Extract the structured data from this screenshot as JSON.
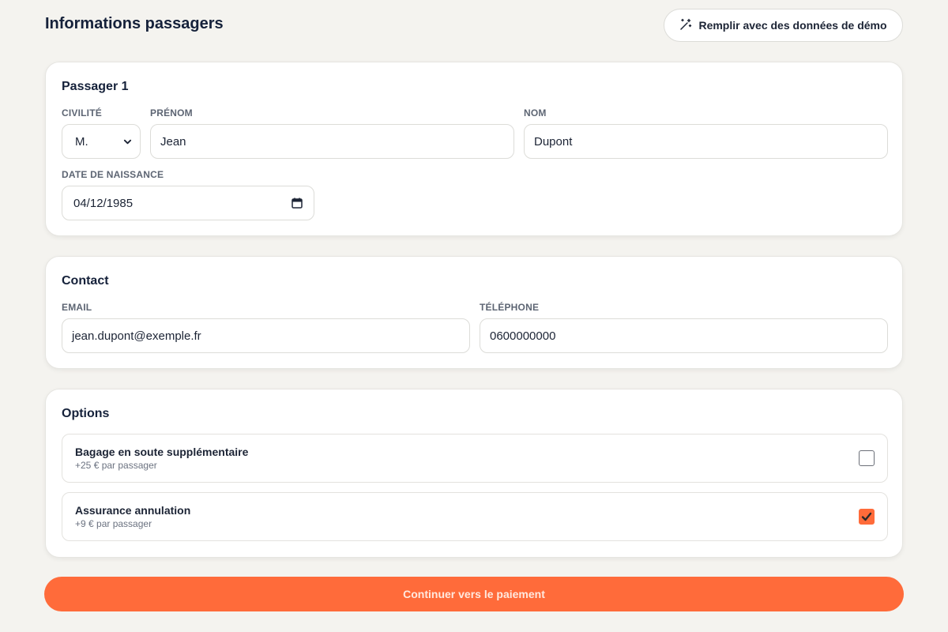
{
  "page": {
    "title": "Informations passagers",
    "demo_button_label": "Remplir avec des données de démo",
    "demo_icon": "magic-wand-icon"
  },
  "passenger": {
    "title": "Passager 1",
    "civility_label": "CIVILITÉ",
    "civility_value": "M.",
    "firstname_label": "PRÉNOM",
    "firstname_value": "Jean",
    "lastname_label": "NOM",
    "lastname_value": "Dupont",
    "birthdate_label": "DATE DE NAISSANCE",
    "birthdate_value": "04/12/1985"
  },
  "contact": {
    "title": "Contact",
    "email_label": "EMAIL",
    "email_value": "jean.dupont@exemple.fr",
    "phone_label": "TÉLÉPHONE",
    "phone_value": "0600000000"
  },
  "options": {
    "title": "Options",
    "items": [
      {
        "title": "Bagage en soute supplémentaire",
        "subtitle": "+25 € par passager",
        "checked": false
      },
      {
        "title": "Assurance annulation",
        "subtitle": "+9 € par passager",
        "checked": true
      }
    ]
  },
  "footer": {
    "continue_label": "Continuer vers le paiement"
  },
  "colors": {
    "accent": "#ff6b3a",
    "background": "#f4f3ef",
    "text_dark": "#15213a"
  }
}
